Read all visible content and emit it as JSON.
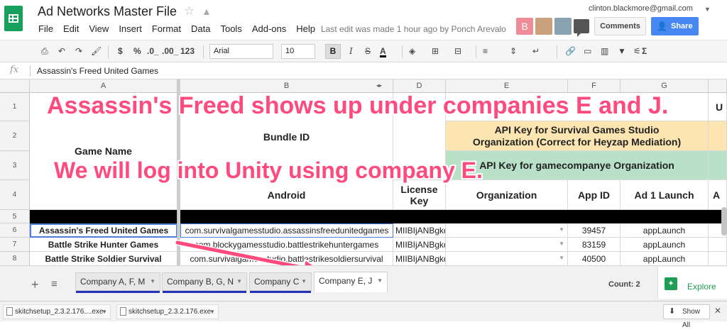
{
  "app": {
    "doc_title": "Ad Networks Master File",
    "menu": [
      "File",
      "Edit",
      "View",
      "Insert",
      "Format",
      "Data",
      "Tools",
      "Add-ons",
      "Help"
    ],
    "last_edit": "Last edit was made 1 hour ago by Ponch Arevalo",
    "account_email": "clinton.blackmore@gmail.com",
    "avatar_letter": "B",
    "comments_label": "Comments",
    "share_label": "Share"
  },
  "toolbar": {
    "currency": "$",
    "percent": "%",
    "dec_less": ".0_",
    "dec_more": ".00_",
    "number_format": "123",
    "font_family": "Arial",
    "font_size": "10",
    "bold": "B",
    "italic": "I",
    "strike": "S",
    "text_color": "A",
    "sigma": "Σ"
  },
  "formula": {
    "fx": "fx",
    "value": "Assassin's Freed United Games"
  },
  "columns": [
    "A",
    "B",
    "D",
    "E",
    "F",
    "G"
  ],
  "rows": [
    "1",
    "2",
    "3",
    "4",
    "5",
    "6",
    "7",
    "8"
  ],
  "headers": {
    "game_name": "Game Name",
    "bundle_id": "Bundle ID",
    "android": "Android",
    "license_key": "License Key",
    "api_key_survival": "API Key for Survival Games Studio Organization (Correct for Heyzap Mediation)",
    "api_key_gamecompanye": "API Key for gamecompanye Organization",
    "organization": "Organization",
    "app_id": "App ID",
    "ad1_launch": "Ad 1 Launch",
    "h_partial": "A",
    "u_partial": "U"
  },
  "data_rows": [
    {
      "game": "Assassin's Freed United Games",
      "bundle": "com.survivalgamesstudio.assassinsfreedunitedgames",
      "license": "MIIBIjANBgkq",
      "app_id": "39457",
      "launch": "appLaunch"
    },
    {
      "game": "Battle Strike Hunter Games",
      "bundle": "com.blockygamesstudio.battlestrikehuntergames",
      "license": "MIIBIjANBgkq",
      "app_id": "83159",
      "launch": "appLaunch"
    },
    {
      "game": "Battle Strike Soldier Survival",
      "bundle": "com.survivalgamesstudio.battlestrikesoldiersurvival",
      "license": "MIIBIjANBgkq",
      "app_id": "40500",
      "launch": "appLaunch"
    }
  ],
  "annotations": {
    "line1": "Assassin's Freed shows up under companies E and J.",
    "line2": "We will log into Unity using company E."
  },
  "sheet_tabs": [
    "Company A, F, M",
    "Company B, G, N",
    "Company C",
    "Company E, J"
  ],
  "status": {
    "count": "Count: 2",
    "explore": "Explore"
  },
  "downloads": {
    "items": [
      "skitchsetup_2.3.2.176....exe",
      "skitchsetup_2.3.2.176.exe"
    ],
    "show_all": "Show All"
  },
  "colors": {
    "accent_pink": "#ff4a7e",
    "api_key_orange": "#fce5b0",
    "api_key_green": "#b8e1c8",
    "share_blue": "#4787f2",
    "sheets_green": "#16a05c",
    "tab_underline": "#2330b8"
  }
}
